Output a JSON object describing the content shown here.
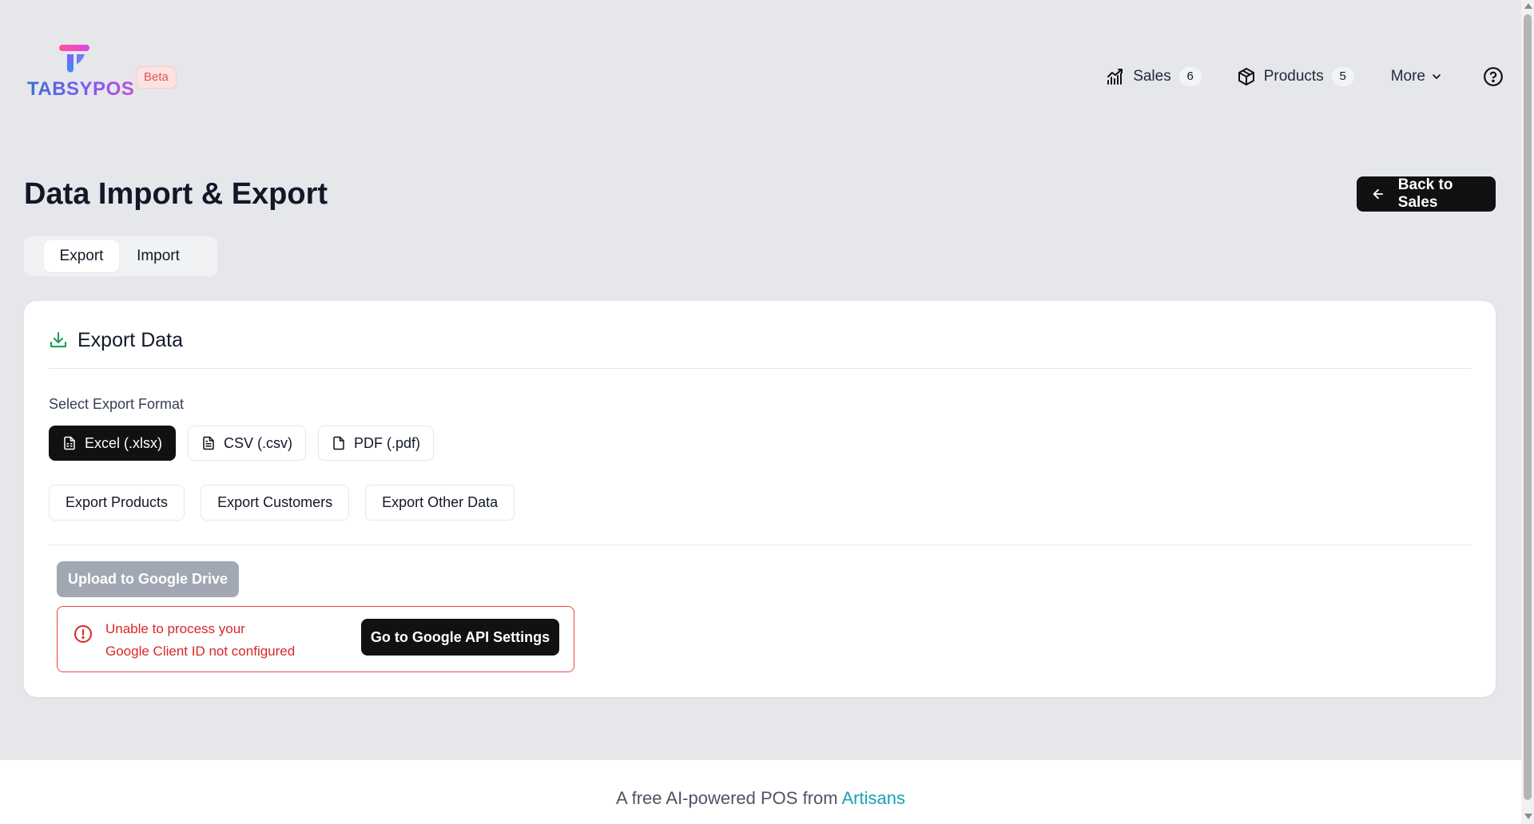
{
  "app": {
    "logo_text": "TABSYPOS",
    "beta_label": "Beta"
  },
  "nav": {
    "sales_label": "Sales",
    "sales_count": "6",
    "products_label": "Products",
    "products_count": "5",
    "more_label": "More"
  },
  "page": {
    "title": "Data Import & Export",
    "back_label": "Back to Sales"
  },
  "tabs": [
    {
      "label": "Export",
      "active": true
    },
    {
      "label": "Import",
      "active": false
    }
  ],
  "export": {
    "title": "Export Data",
    "format_label": "Select Export Format",
    "formats": [
      {
        "label": "Excel (.xlsx)",
        "active": true
      },
      {
        "label": "CSV (.csv)",
        "active": false
      },
      {
        "label": "PDF (.pdf)",
        "active": false
      }
    ],
    "actions": [
      "Export Products",
      "Export Customers",
      "Export Other Data"
    ],
    "drive_label": "Upload to Google Drive",
    "error_line1": "Unable to process your",
    "error_line2": "Google Client ID not configured",
    "api_settings_label": "Go to Google API Settings"
  },
  "footer": {
    "text": "A free AI-powered POS from",
    "link": "Artisans"
  },
  "colors": {
    "background": "#e5e7eb",
    "primary_button": "#111111",
    "error": "#dc2626",
    "export_icon": "#22a35a",
    "link": "#17a2b8",
    "beta_bg": "#fde2e2"
  }
}
